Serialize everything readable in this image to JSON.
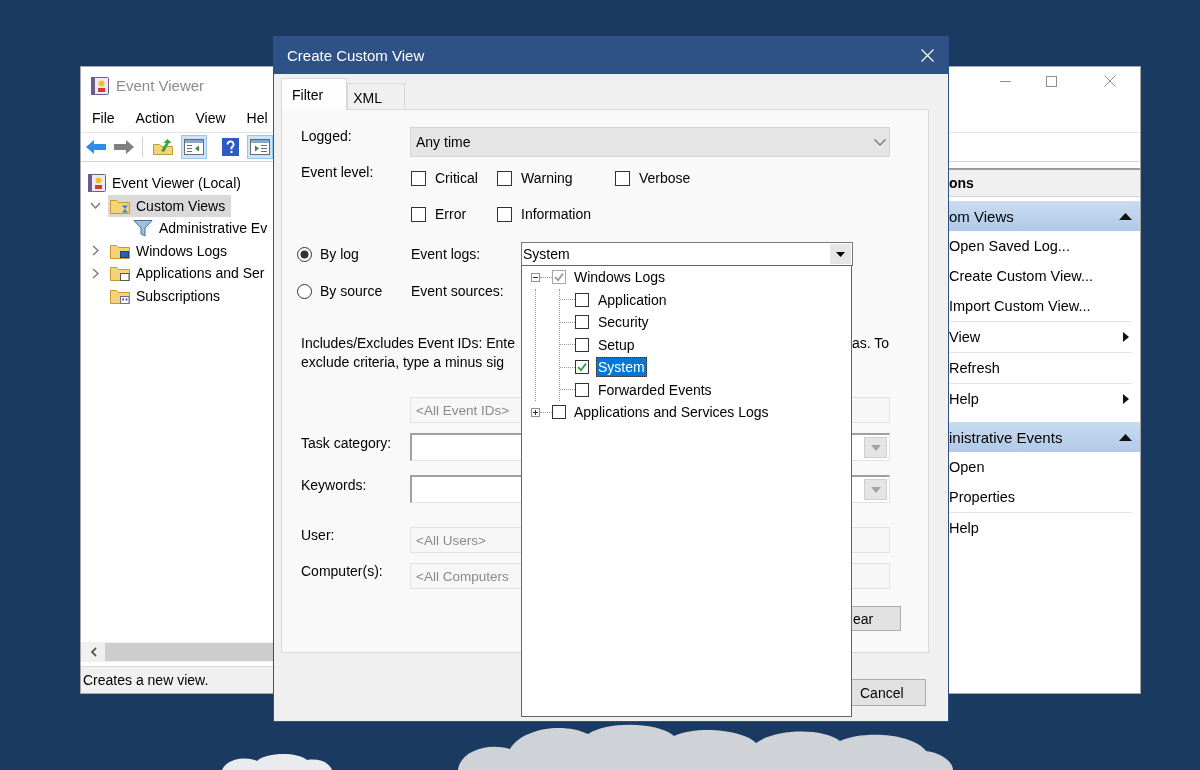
{
  "event_viewer": {
    "title": "Event Viewer",
    "menu": [
      "File",
      "Action",
      "View",
      "Hel"
    ],
    "toolbar": [
      [
        {
          "kind": "back",
          "pressed": false
        },
        {
          "kind": "forward",
          "pressed": false
        }
      ],
      [
        {
          "kind": "up",
          "pressed": false
        },
        {
          "kind": "tree-pane",
          "pressed": true
        },
        {
          "kind": "help",
          "pressed": false
        },
        {
          "kind": "action-pane",
          "pressed": true
        }
      ]
    ],
    "tree": [
      {
        "label": "Event Viewer (Local)",
        "kind": "viewer",
        "selected": false,
        "children": [
          {
            "label": "Custom Views",
            "kind": "custom",
            "expanded": true,
            "selected": true,
            "children": [
              {
                "label": "Administrative Ev",
                "kind": "filter",
                "selected": false
              }
            ]
          },
          {
            "label": "Windows Logs",
            "kind": "logs",
            "expanded": false,
            "selected": false
          },
          {
            "label": "Applications and Ser",
            "kind": "apps",
            "expanded": false,
            "selected": false
          },
          {
            "label": "Subscriptions",
            "kind": "subscriptions",
            "selected": false
          }
        ]
      }
    ],
    "status_bar": "Creates a new view.",
    "actions": {
      "header": "ons",
      "sections": [
        {
          "title": "om Views",
          "expanded": true,
          "groups": [
            [
              {
                "label": "Open Saved Log...",
                "submenu": false
              },
              {
                "label": "Create Custom View...",
                "submenu": false
              },
              {
                "label": "Import Custom View...",
                "submenu": false
              }
            ],
            [
              {
                "label": "View",
                "submenu": true
              }
            ],
            [
              {
                "label": "Refresh",
                "submenu": false
              }
            ],
            [
              {
                "label": "Help",
                "submenu": true
              }
            ]
          ]
        },
        {
          "title": "inistrative Events",
          "expanded": true,
          "groups": [
            [
              {
                "label": "Open",
                "submenu": false
              },
              {
                "label": "Properties",
                "submenu": false
              }
            ],
            [
              {
                "label": "Help",
                "submenu": false
              }
            ]
          ]
        }
      ]
    }
  },
  "dialog": {
    "title": "Create Custom View",
    "tabs": [
      {
        "label": "Filter",
        "selected": true
      },
      {
        "label": "XML",
        "selected": false
      }
    ],
    "logged": {
      "label": "Logged:",
      "value": "Any time"
    },
    "event_level": {
      "label": "Event level:",
      "options": [
        {
          "label": "Critical",
          "checked": false
        },
        {
          "label": "Warning",
          "checked": false
        },
        {
          "label": "Verbose",
          "checked": false
        },
        {
          "label": "Error",
          "checked": false
        },
        {
          "label": "Information",
          "checked": false
        }
      ]
    },
    "filter_by": [
      {
        "label": "By log",
        "selected": true,
        "field_label": "Event logs:",
        "value": "System"
      },
      {
        "label": "By source",
        "selected": false,
        "field_label": "Event sources:"
      }
    ],
    "event_ids": {
      "text": "Includes/Excludes Event IDs: Ente\nexclude criteria, type a minus sig",
      "text_right": "as. To",
      "placeholder": "<All Event IDs>"
    },
    "task_category": {
      "label": "Task category:"
    },
    "keywords": {
      "label": "Keywords:"
    },
    "user": {
      "label": "User:",
      "placeholder": "<All Users>"
    },
    "computers": {
      "label": "Computer(s):",
      "placeholder": "<All Computers"
    },
    "clear_button": "ear",
    "cancel_button": "Cancel",
    "log_tree": [
      {
        "label": "Windows Logs",
        "expanded": true,
        "checked": true,
        "mixed": true,
        "selected": false,
        "children": [
          {
            "label": "Application",
            "checked": false,
            "selected": false
          },
          {
            "label": "Security",
            "checked": false,
            "selected": false
          },
          {
            "label": "Setup",
            "checked": false,
            "selected": false
          },
          {
            "label": "System",
            "checked": true,
            "selected": true
          },
          {
            "label": "Forwarded Events",
            "checked": false,
            "selected": false
          }
        ]
      },
      {
        "label": "Applications and Services Logs",
        "expanded": false,
        "checked": false,
        "mixed": false,
        "selected": false
      }
    ]
  }
}
